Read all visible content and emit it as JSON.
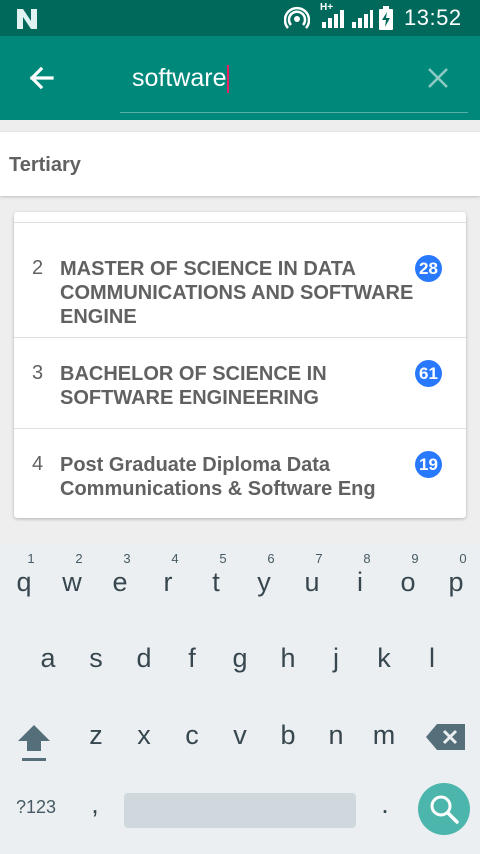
{
  "status_bar": {
    "time": "13:52",
    "network": "H+"
  },
  "search": {
    "value": "software"
  },
  "section": {
    "title": "Tertiary"
  },
  "results": [
    {
      "num": "2",
      "title": "MASTER OF SCIENCE IN DATA COMMUNICATIONS AND SOFTWARE ENGINE",
      "count": "28"
    },
    {
      "num": "3",
      "title": "BACHELOR OF SCIENCE IN SOFTWARE ENGINEERING",
      "count": "61"
    },
    {
      "num": "4",
      "title": "Post Graduate Diploma Data Communications & Software Eng",
      "count": "19"
    }
  ],
  "keyboard": {
    "row1": [
      {
        "key": "q",
        "hint": "1"
      },
      {
        "key": "w",
        "hint": "2"
      },
      {
        "key": "e",
        "hint": "3"
      },
      {
        "key": "r",
        "hint": "4"
      },
      {
        "key": "t",
        "hint": "5"
      },
      {
        "key": "y",
        "hint": "6"
      },
      {
        "key": "u",
        "hint": "7"
      },
      {
        "key": "i",
        "hint": "8"
      },
      {
        "key": "o",
        "hint": "9"
      },
      {
        "key": "p",
        "hint": "0"
      }
    ],
    "row2": [
      "a",
      "s",
      "d",
      "f",
      "g",
      "h",
      "j",
      "k",
      "l"
    ],
    "row3": [
      "z",
      "x",
      "c",
      "v",
      "b",
      "n",
      "m"
    ],
    "symbols_label": "?123",
    "comma": ",",
    "period": "."
  },
  "colors": {
    "status_bar": "#00695c",
    "app_bar": "#00897b",
    "badge": "#2979ff",
    "search_key": "#4db6ac",
    "cursor": "#e91e63"
  }
}
